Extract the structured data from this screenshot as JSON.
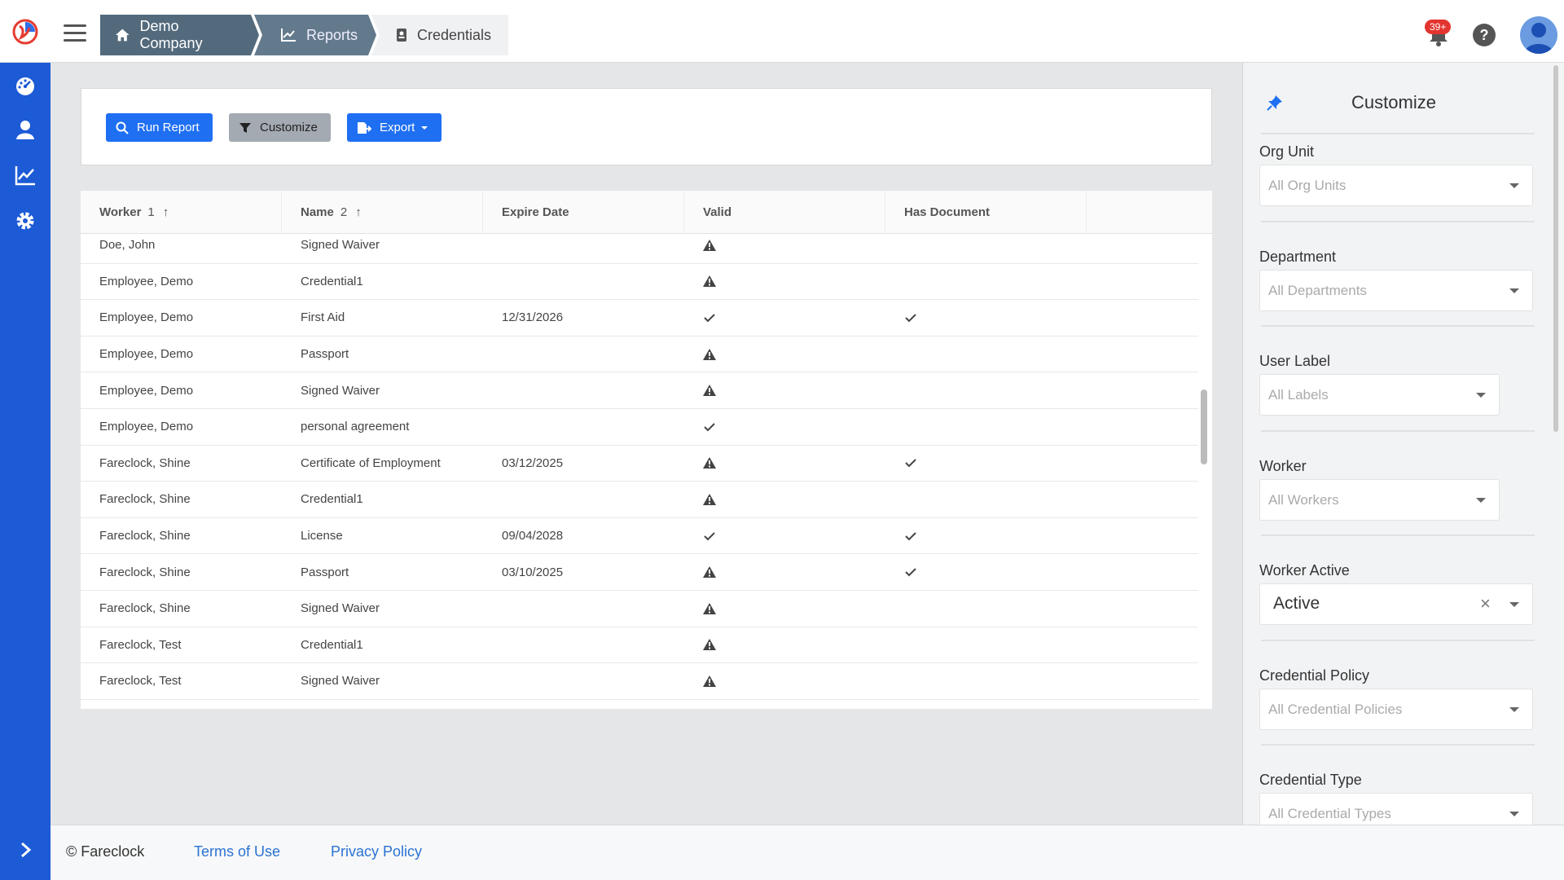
{
  "header": {
    "breadcrumbs": [
      "Demo Company",
      "Reports",
      "Credentials"
    ],
    "notification_badge": "39+",
    "help_label": "?"
  },
  "toolbar": {
    "run_label": "Run Report",
    "customize_label": "Customize",
    "export_label": "Export"
  },
  "table": {
    "columns": [
      "Worker",
      "Name",
      "Expire Date",
      "Valid",
      "Has Document"
    ],
    "sort": [
      {
        "column": "Worker",
        "order": "1",
        "direction": "asc"
      },
      {
        "column": "Name",
        "order": "2",
        "direction": "asc"
      }
    ],
    "rows": [
      {
        "worker": "Doe, John",
        "name": "Signed Waiver",
        "expire": "",
        "valid": "warning",
        "doc": false
      },
      {
        "worker": "Employee, Demo",
        "name": "Credential1",
        "expire": "",
        "valid": "warning",
        "doc": false
      },
      {
        "worker": "Employee, Demo",
        "name": "First Aid",
        "expire": "12/31/2026",
        "valid": "check",
        "doc": true
      },
      {
        "worker": "Employee, Demo",
        "name": "Passport",
        "expire": "",
        "valid": "warning",
        "doc": false
      },
      {
        "worker": "Employee, Demo",
        "name": "Signed Waiver",
        "expire": "",
        "valid": "warning",
        "doc": false
      },
      {
        "worker": "Employee, Demo",
        "name": "personal agreement",
        "expire": "",
        "valid": "check",
        "doc": false
      },
      {
        "worker": "Fareclock, Shine",
        "name": "Certificate of Employment",
        "expire": "03/12/2025",
        "valid": "warning",
        "doc": true
      },
      {
        "worker": "Fareclock, Shine",
        "name": "Credential1",
        "expire": "",
        "valid": "warning",
        "doc": false
      },
      {
        "worker": "Fareclock, Shine",
        "name": "License",
        "expire": "09/04/2028",
        "valid": "check",
        "doc": true
      },
      {
        "worker": "Fareclock, Shine",
        "name": "Passport",
        "expire": "03/10/2025",
        "valid": "warning",
        "doc": true
      },
      {
        "worker": "Fareclock, Shine",
        "name": "Signed Waiver",
        "expire": "",
        "valid": "warning",
        "doc": false
      },
      {
        "worker": "Fareclock, Test",
        "name": "Credential1",
        "expire": "",
        "valid": "warning",
        "doc": false
      },
      {
        "worker": "Fareclock, Test",
        "name": "Signed Waiver",
        "expire": "",
        "valid": "warning",
        "doc": false
      }
    ]
  },
  "panel": {
    "title": "Customize",
    "filters": [
      {
        "label": "Org Unit",
        "placeholder": "All Org Units",
        "value": ""
      },
      {
        "label": "Department",
        "placeholder": "All Departments",
        "value": ""
      },
      {
        "label": "User Label",
        "placeholder": "All Labels",
        "value": ""
      },
      {
        "label": "Worker",
        "placeholder": "All Workers",
        "value": ""
      },
      {
        "label": "Worker Active",
        "placeholder": "",
        "value": "Active"
      },
      {
        "label": "Credential Policy",
        "placeholder": "All Credential Policies",
        "value": ""
      },
      {
        "label": "Credential Type",
        "placeholder": "All Credential Types",
        "value": ""
      }
    ]
  },
  "footer": {
    "copyright": "© Fareclock",
    "terms": "Terms of Use",
    "privacy": "Privacy Policy"
  },
  "colors": {
    "primary": "#1f6ff2",
    "rail": "#1c5ad6",
    "breadcrumb_dark": "#536a7c",
    "link": "#2a72d4",
    "badge": "#e3342f"
  }
}
